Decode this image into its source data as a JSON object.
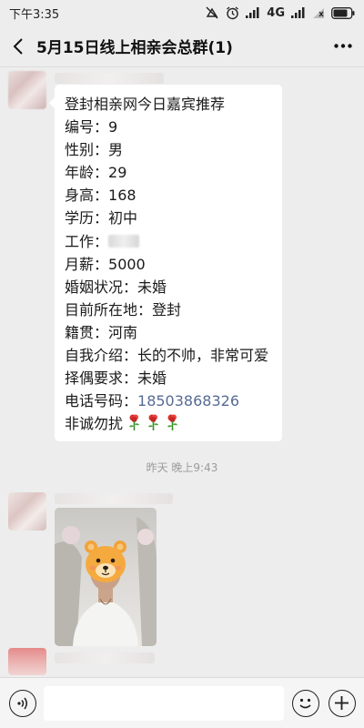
{
  "status_bar": {
    "time": "下午3:35",
    "network": "4G",
    "icons": [
      "mute-icon",
      "alarm-icon",
      "signal-icon",
      "signal-icon",
      "no-sim-icon",
      "battery-icon"
    ]
  },
  "header": {
    "back_icon": "chevron-left-icon",
    "title": "5月15日线上相亲会总群(1)",
    "more_icon": "more-dots-icon"
  },
  "messages": [
    {
      "type": "text",
      "lines": [
        {
          "text": "登封相亲网今日嘉宾推荐"
        },
        {
          "label": "编号：",
          "value": "9"
        },
        {
          "label": "性别：",
          "value": "男"
        },
        {
          "label": "年龄：",
          "value": "29"
        },
        {
          "label": "身高：",
          "value": "168"
        },
        {
          "label": "学历：",
          "value": "初中"
        },
        {
          "label": "工作：",
          "value": ""
        },
        {
          "label": "月薪：",
          "value": "5000"
        },
        {
          "label": "婚姻状况：",
          "value": "未婚"
        },
        {
          "label": "目前所在地：",
          "value": "登封"
        },
        {
          "label": "籍贯：",
          "value": "河南"
        },
        {
          "label": "自我介绍：",
          "value": "长的不帅，非常可爱"
        },
        {
          "label": "择偶要求：",
          "value": "未婚"
        },
        {
          "label": "电话号码：",
          "value": "18503868326"
        },
        {
          "text": "非诚勿扰"
        }
      ],
      "emoji": [
        "rose-icon",
        "rose-icon",
        "rose-icon"
      ]
    },
    {
      "type": "timestamp",
      "text": "昨天 晚上9:43"
    },
    {
      "type": "image",
      "icon": "bear-face-sticker-icon"
    }
  ],
  "input_bar": {
    "voice_icon": "voice-icon",
    "input_value": "",
    "emoji_icon": "smiley-icon",
    "plus_icon": "plus-icon"
  },
  "colors": {
    "background": "#ededed",
    "bubble": "#ffffff",
    "link": "#576b95",
    "timestamp": "#9b9b9b"
  }
}
